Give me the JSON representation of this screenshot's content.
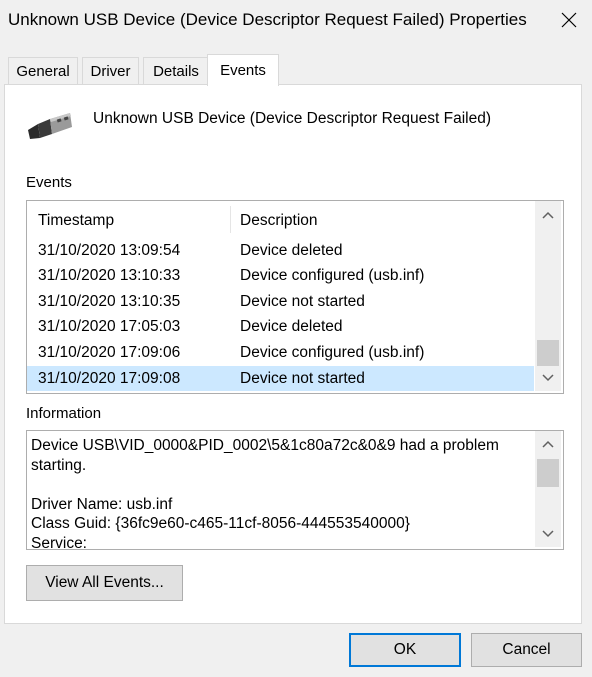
{
  "window": {
    "title": "Unknown USB Device (Device Descriptor Request Failed) Properties"
  },
  "tabs": [
    {
      "label": "General"
    },
    {
      "label": "Driver"
    },
    {
      "label": "Details"
    },
    {
      "label": "Events",
      "active": true
    }
  ],
  "device": {
    "name": "Unknown USB Device (Device Descriptor Request Failed)",
    "icon": "usb-plug-icon"
  },
  "events": {
    "label": "Events",
    "columns": [
      "Timestamp",
      "Description"
    ],
    "rows": [
      {
        "timestamp": "31/10/2020 13:09:54",
        "description": "Device deleted"
      },
      {
        "timestamp": "31/10/2020 13:10:33",
        "description": "Device configured (usb.inf)"
      },
      {
        "timestamp": "31/10/2020 13:10:35",
        "description": "Device not started"
      },
      {
        "timestamp": "31/10/2020 17:05:03",
        "description": "Device deleted"
      },
      {
        "timestamp": "31/10/2020 17:09:06",
        "description": "Device configured (usb.inf)"
      },
      {
        "timestamp": "31/10/2020 17:09:08",
        "description": "Device not started",
        "selected": true
      }
    ]
  },
  "information": {
    "label": "Information",
    "text": "Device USB\\VID_0000&PID_0002\\5&1c80a72c&0&9 had a problem starting.\n\nDriver Name: usb.inf\nClass Guid: {36fc9e60-c465-11cf-8056-444553540000}\nService:"
  },
  "buttons": {
    "view_all": "View All Events...",
    "ok": "OK",
    "cancel": "Cancel"
  },
  "colors": {
    "selection": "#cce8ff",
    "default_button_border": "#0078d7"
  }
}
